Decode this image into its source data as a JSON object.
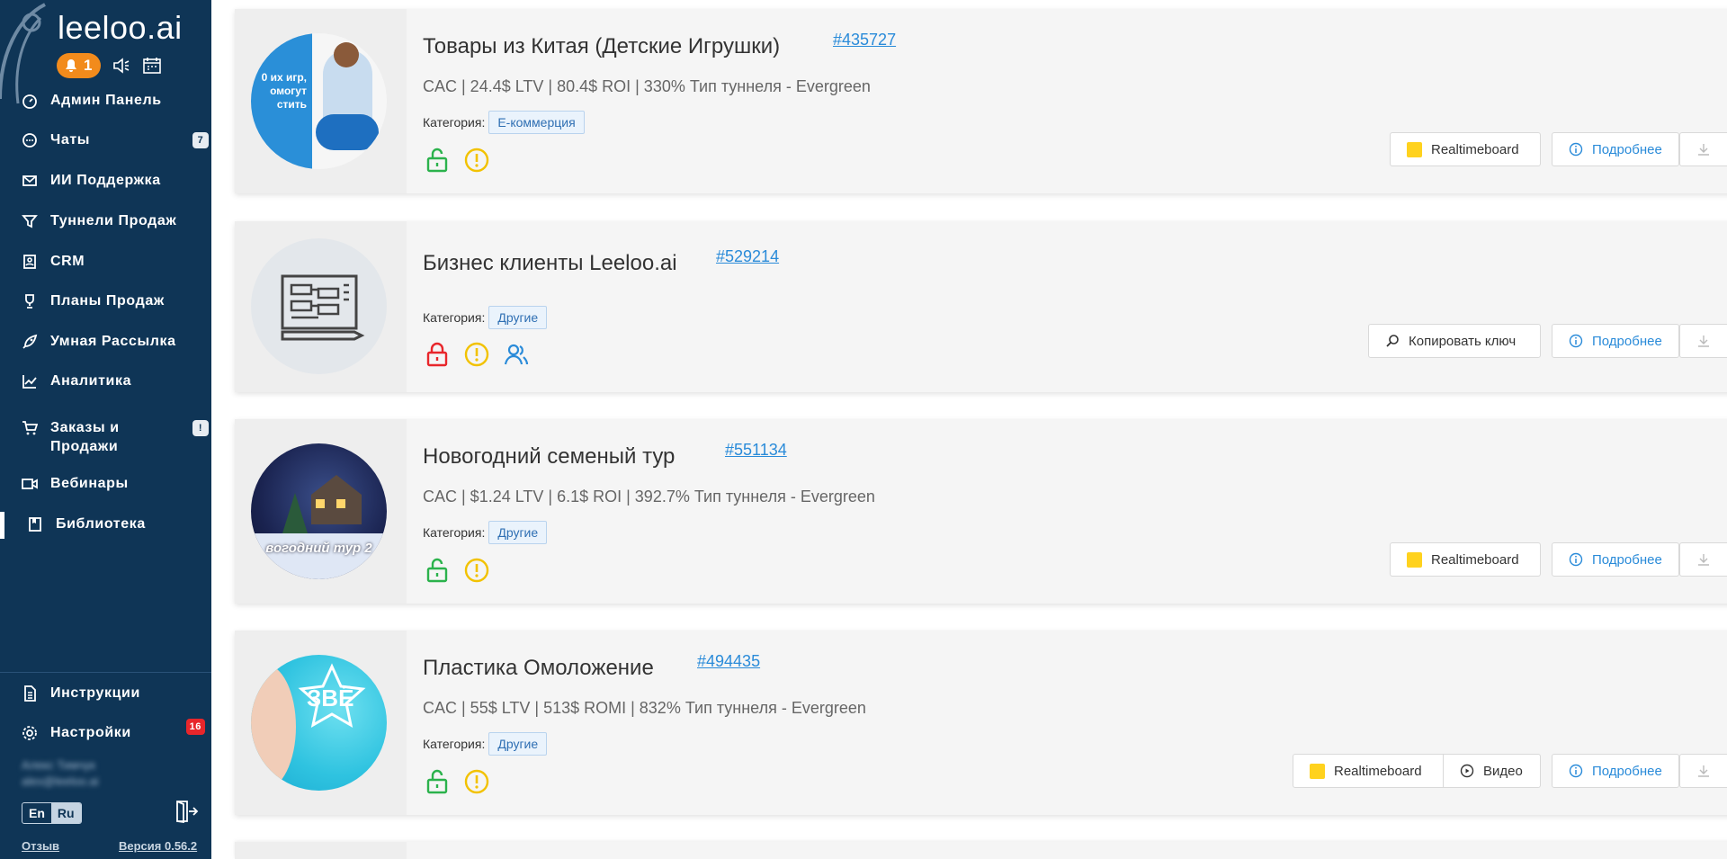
{
  "sidebar": {
    "logo": "leeloo.ai",
    "notifications_count": "1",
    "nav": [
      {
        "label": "Админ Панель",
        "icon": "dashboard-icon"
      },
      {
        "label": "Чаты",
        "icon": "chat-icon",
        "badge": "7"
      },
      {
        "label": "ИИ Поддержка",
        "icon": "mail-icon"
      },
      {
        "label": "Туннели Продаж",
        "icon": "funnel-icon"
      },
      {
        "label": "CRM",
        "icon": "contacts-icon"
      },
      {
        "label": "Планы Продаж",
        "icon": "trophy-icon"
      },
      {
        "label": "Умная Рассылка",
        "icon": "rocket-icon"
      },
      {
        "label": "Аналитика",
        "icon": "chart-icon"
      },
      {
        "label_line1": "Заказы и",
        "label_line2": "Продажи",
        "icon": "cart-icon",
        "badge": "!"
      },
      {
        "label": "Вебинары",
        "icon": "video-icon"
      },
      {
        "label": "Библиотека",
        "icon": "book-icon",
        "active": true
      }
    ],
    "bottom": [
      {
        "label": "Инструкции",
        "icon": "document-icon"
      },
      {
        "label": "Настройки",
        "icon": "gear-icon",
        "badge": "16"
      }
    ],
    "user_name": "Алекс Тимчук",
    "user_email": "alex@leeloo.ai",
    "lang": {
      "en": "En",
      "ru": "Ru",
      "selected": "Ru"
    },
    "feedback": "Отзыв",
    "version": "Версия 0.56.2"
  },
  "cards": [
    {
      "title": "Товары из Китая (Детские Игрушки)",
      "id": "#435727",
      "metrics": "CAC | 24.4$ LTV | 80.4$ ROI | 330% Тип туннеля - Evergreen",
      "category_label": "Категория:",
      "category": "Е-коммерция",
      "buttons": [
        "Realtimeboard",
        "Подробнее"
      ],
      "thumb_text": "0 их игр, омогут стить"
    },
    {
      "title": "Бизнес клиенты Leeloo.ai",
      "id": "#529214",
      "metrics": "",
      "category_label": "Категория:",
      "category": "Другие",
      "buttons": [
        "Копировать ключ",
        "Подробнее"
      ]
    },
    {
      "title": "Новогодний семеный тур",
      "id": "#551134",
      "metrics": "CAC | $1.24 LTV | 6.1$ ROI | 392.7% Тип туннеля - Evergreen",
      "category_label": "Категория:",
      "category": "Другие",
      "buttons": [
        "Realtimeboard",
        "Подробнее"
      ],
      "thumb_text": "вогодний тур 2"
    },
    {
      "title": "Пластика Омоложение",
      "id": "#494435",
      "metrics": "CAC | 55$ LTV | 513$ ROMI | 832% Тип туннеля - Evergreen",
      "category_label": "Категория:",
      "category": "Другие",
      "buttons": [
        "Realtimeboard",
        "Видео",
        "Подробнее"
      ],
      "thumb_text": "ЗВЁ"
    }
  ],
  "colors": {
    "sidebar_bg": "#0f3556",
    "accent_blue": "#2a8bd9",
    "notif_orange": "#f28b1c",
    "lock_open_green": "#2bb24c",
    "lock_closed_red": "#e8262b",
    "warning_yellow": "#f2c200",
    "realtimeboard_yellow": "#ffd21e"
  }
}
